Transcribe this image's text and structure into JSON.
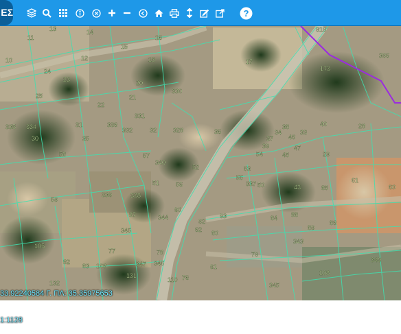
{
  "toolbar": {
    "brand": "ΕΣ",
    "colors": {
      "bar": "#1e98e8",
      "brand_bg": "#0b5f99",
      "icon": "#ffffff"
    },
    "icons": [
      "layers-icon",
      "search-icon",
      "grid-icon",
      "info-icon",
      "clear-icon",
      "zoom-in-icon",
      "zoom-out-icon",
      "back-icon",
      "home-icon",
      "print-icon",
      "measure-icon",
      "edit-icon",
      "export-icon",
      "help-icon"
    ]
  },
  "map": {
    "parcel_line_color": "#3fe0b0",
    "boundary_color": "#9b2be0",
    "labels": [
      "13",
      "14",
      "919",
      "396",
      "11",
      "15",
      "16",
      "17",
      "173",
      "10",
      "12",
      "18",
      "24",
      "23",
      "20",
      "330",
      "25",
      "21",
      "22",
      "331",
      "336",
      "335",
      "334",
      "31",
      "332",
      "32",
      "328",
      "36",
      "38",
      "33",
      "39",
      "40",
      "28",
      "30",
      "35",
      "34",
      "37",
      "46",
      "47",
      "45",
      "29",
      "58",
      "57",
      "340",
      "54",
      "52",
      "53",
      "55",
      "56",
      "51",
      "50",
      "337",
      "43",
      "61",
      "60",
      "59",
      "339",
      "338",
      "85",
      "86",
      "87",
      "344",
      "90",
      "92",
      "93",
      "84",
      "88",
      "89",
      "345",
      "62",
      "80",
      "343",
      "105",
      "77",
      "78",
      "79",
      "82",
      "83",
      "106",
      "347",
      "346",
      "91",
      "108",
      "349",
      "131",
      "76",
      "110",
      "345",
      "132"
    ]
  },
  "status": {
    "coords_line": "33.92240584 Γ. ΠΛ: 35.35975653",
    "scale_line": "1:1128"
  }
}
